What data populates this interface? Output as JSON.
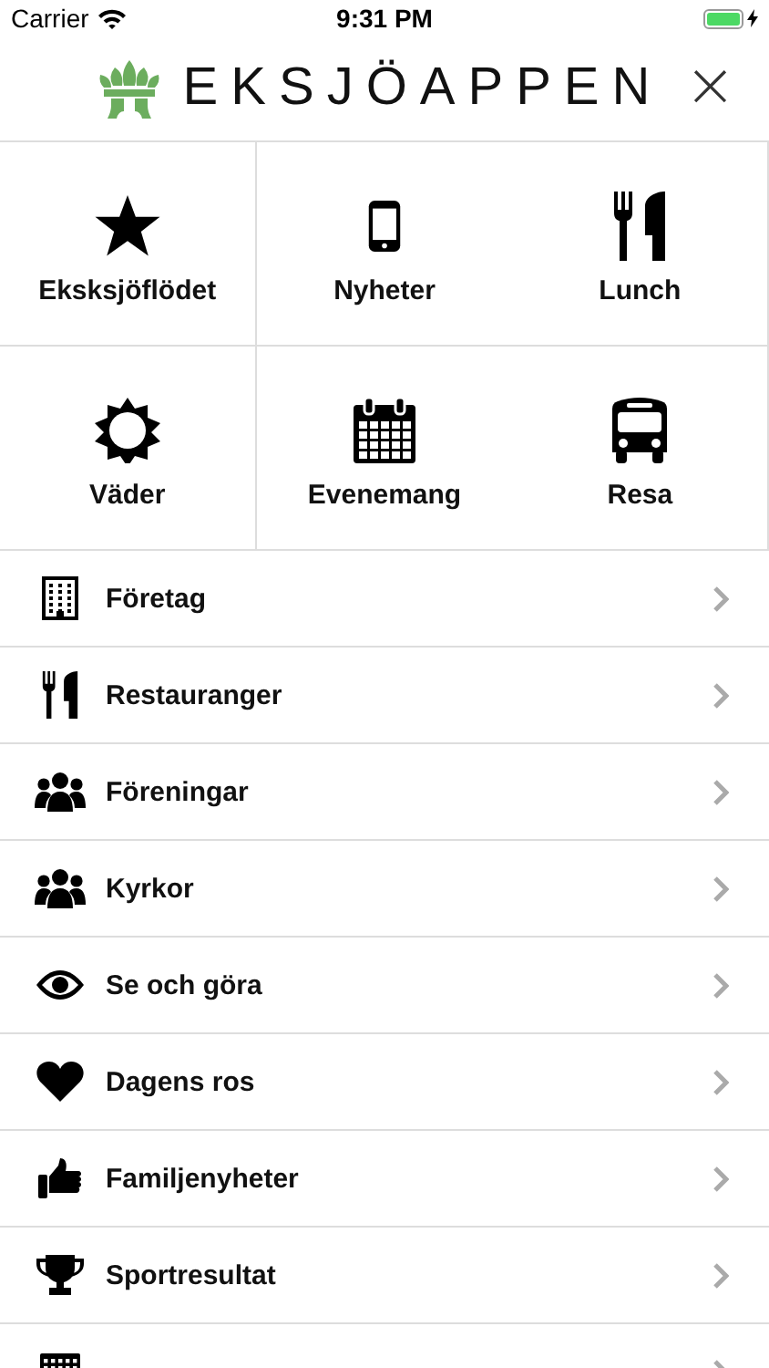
{
  "status_bar": {
    "carrier": "Carrier",
    "time": "9:31 PM"
  },
  "header": {
    "title": "EKSJÖAPPEN",
    "close": "×"
  },
  "tiles": [
    {
      "label": "Eksksjöflödet"
    },
    {
      "label": "Nyheter"
    },
    {
      "label": "Lunch"
    },
    {
      "label": "Väder"
    },
    {
      "label": "Evenemang"
    },
    {
      "label": "Resa"
    }
  ],
  "menu": [
    {
      "label": "Företag"
    },
    {
      "label": "Restauranger"
    },
    {
      "label": "Föreningar"
    },
    {
      "label": "Kyrkor"
    },
    {
      "label": "Se och göra"
    },
    {
      "label": "Dagens ros"
    },
    {
      "label": "Familjenyheter"
    },
    {
      "label": "Sportresultat"
    }
  ]
}
